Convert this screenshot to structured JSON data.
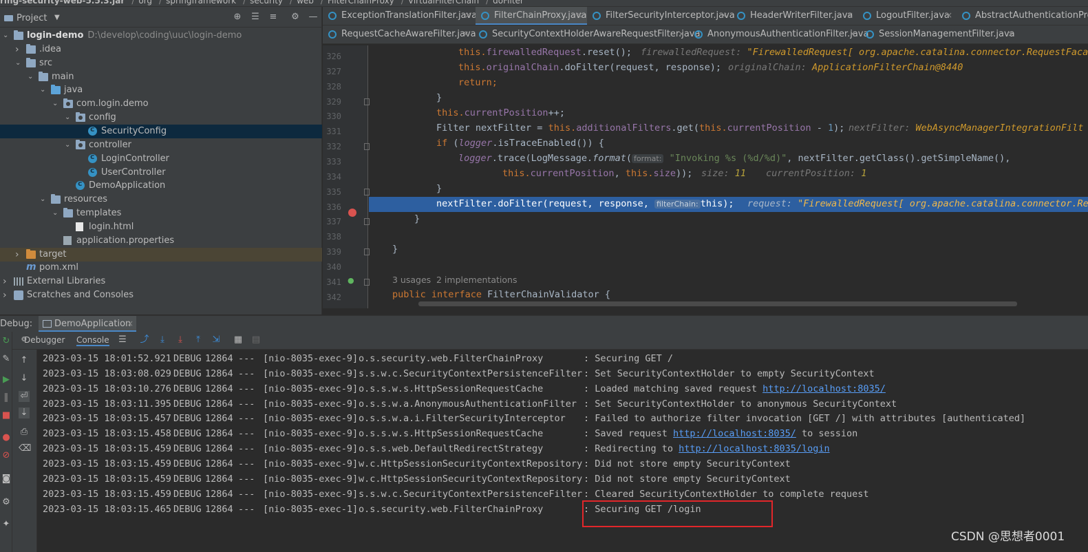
{
  "breadcrumb": {
    "items": [
      "ring-security-web-5.5.3.jar",
      "org",
      "springframework",
      "security",
      "web",
      "FilterChainProxy",
      "VirtualFilterChain",
      "doFilter"
    ]
  },
  "project": {
    "title": "Project",
    "tree": [
      {
        "label": "login-demo",
        "path": "D:\\develop\\coding\\uuc\\login-demo",
        "icon": "folder-icon",
        "level": 0,
        "expanded": true,
        "bold": true
      },
      {
        "label": ".idea",
        "icon": "folder-icon",
        "level": 1,
        "expanded": false
      },
      {
        "label": "src",
        "icon": "folder-icon",
        "level": 1,
        "expanded": true
      },
      {
        "label": "main",
        "icon": "folder-icon",
        "level": 2,
        "expanded": true
      },
      {
        "label": "java",
        "icon": "source-folder-icon",
        "level": 3,
        "expanded": true
      },
      {
        "label": "com.login.demo",
        "icon": "package-icon",
        "level": 4,
        "expanded": true
      },
      {
        "label": "config",
        "icon": "package-icon",
        "level": 5,
        "expanded": true
      },
      {
        "label": "SecurityConfig",
        "icon": "class-icon",
        "level": 6,
        "selected": true
      },
      {
        "label": "controller",
        "icon": "package-icon",
        "level": 5,
        "expanded": true
      },
      {
        "label": "LoginController",
        "icon": "class-icon",
        "level": 6
      },
      {
        "label": "UserController",
        "icon": "class-icon",
        "level": 6
      },
      {
        "label": "DemoApplication",
        "icon": "class-icon",
        "level": 5
      },
      {
        "label": "resources",
        "icon": "resources-folder-icon",
        "level": 3,
        "expanded": true
      },
      {
        "label": "templates",
        "icon": "folder-icon",
        "level": 4,
        "expanded": true
      },
      {
        "label": "login.html",
        "icon": "html-file-icon",
        "level": 5
      },
      {
        "label": "application.properties",
        "icon": "properties-file-icon",
        "level": 4
      },
      {
        "label": "target",
        "icon": "excluded-folder-icon",
        "level": 1,
        "expanded": false
      },
      {
        "label": "pom.xml",
        "icon": "maven-icon",
        "level": 1
      },
      {
        "label": "External Libraries",
        "icon": "libraries-icon",
        "level": 0,
        "expanded": false
      },
      {
        "label": "Scratches and Consoles",
        "icon": "scratches-icon",
        "level": 0,
        "expanded": false
      }
    ]
  },
  "editor": {
    "tabs_row1": [
      {
        "label": "ExceptionTranslationFilter.java",
        "active": false
      },
      {
        "label": "FilterChainProxy.java",
        "active": true
      },
      {
        "label": "FilterSecurityInterceptor.java",
        "active": false
      },
      {
        "label": "HeaderWriterFilter.java",
        "active": false
      },
      {
        "label": "LogoutFilter.java",
        "active": false
      },
      {
        "label": "AbstractAuthenticationPro",
        "active": false
      }
    ],
    "tabs_row2": [
      {
        "label": "RequestCacheAwareFilter.java",
        "active": false
      },
      {
        "label": "SecurityContextHolderAwareRequestFilter.java",
        "active": false
      },
      {
        "label": "AnonymousAuthenticationFilter.java",
        "active": false
      },
      {
        "label": "SessionManagementFilter.java",
        "active": false
      }
    ],
    "line_numbers": [
      "326",
      "327",
      "328",
      "329",
      "330",
      "331",
      "332",
      "333",
      "334",
      "335",
      "336",
      "337",
      "338",
      "339",
      "340",
      "341",
      "342"
    ],
    "code": {
      "l326a": "this.",
      "l326b": "firewalledRequest",
      "l326c": ".reset();",
      "l326h": "firewalledRequest:",
      "l326v": "\"FirewalledRequest[ org.apache.catalina.connector.RequestFaca",
      "l327a": "this.",
      "l327b": "originalChain",
      "l327c": ".doFilter(request, response);",
      "l327h": "originalChain:",
      "l327v": "ApplicationFilterChain@8440",
      "l328a": "return;",
      "l329a": "}",
      "l330a": "this.",
      "l330b": "currentPosition",
      "l330c": "++;",
      "l331a": "Filter nextFilter = ",
      "l331b": "this.",
      "l331c": "additionalFilters",
      "l331d": ".get(",
      "l331e": "this.",
      "l331f": "currentPosition",
      "l331g": " - ",
      "l331n": "1",
      "l331i": ");",
      "l331h": "nextFilter:",
      "l331v": "WebAsyncManagerIntegrationFilt",
      "l332a": "if",
      "l332b": " (",
      "l332c": "logger",
      "l332d": ".isTraceEnabled()) {",
      "l333a": "logger",
      "l333b": ".trace(LogMessage.",
      "l333c": "format",
      "l333d": "(",
      "l333p": "format:",
      "l333s": "\"Invoking %s (%d/%d)\"",
      "l333e": ", nextFilter.getClass().getSimpleName(),",
      "l334a": "this.",
      "l334b": "currentPosition",
      "l334c": ", ",
      "l334d": "this.",
      "l334e": "size",
      "l334f": "));",
      "l334h1": "size:",
      "l334v1": "11",
      "l334h2": "currentPosition:",
      "l334v2": "1",
      "l335a": "}",
      "l336a": "nextFilter.doFilter(request, response, ",
      "l336p": "filterChain:",
      "l336b": "this",
      "l336c": ");",
      "l336h": "request:",
      "l336v": "\"FirewalledRequest[ org.apache.catalina.connector.Re",
      "l337a": "}",
      "l339a": "}",
      "l340u1": "3 usages",
      "l340u2": "2 implementations",
      "l341a": "public interface",
      "l341b": " FilterChainValidator {"
    }
  },
  "debug": {
    "label": "Debug:",
    "session_tab": "DemoApplication",
    "subtabs": {
      "debugger": "Debugger",
      "console": "Console"
    }
  },
  "console": {
    "lines": [
      {
        "ts": "2023-03-15 18:01:52.921",
        "lvl": "DEBUG",
        "pid": "12864",
        "thread": "[nio-8035-exec-9]",
        "logger": "o.s.security.web.FilterChainProxy",
        "msg": ": Securing GET /",
        "link": "",
        "after": ""
      },
      {
        "ts": "2023-03-15 18:03:08.029",
        "lvl": "DEBUG",
        "pid": "12864",
        "thread": "[nio-8035-exec-9]",
        "logger": "s.s.w.c.SecurityContextPersistenceFilter",
        "msg": ": Set SecurityContextHolder to empty SecurityContext",
        "link": "",
        "after": ""
      },
      {
        "ts": "2023-03-15 18:03:10.276",
        "lvl": "DEBUG",
        "pid": "12864",
        "thread": "[nio-8035-exec-9]",
        "logger": "o.s.s.w.s.HttpSessionRequestCache",
        "msg": ": Loaded matching saved request ",
        "link": "http://localhost:8035/",
        "after": ""
      },
      {
        "ts": "2023-03-15 18:03:11.395",
        "lvl": "DEBUG",
        "pid": "12864",
        "thread": "[nio-8035-exec-9]",
        "logger": "o.s.s.w.a.AnonymousAuthenticationFilter",
        "msg": ": Set SecurityContextHolder to anonymous SecurityContext",
        "link": "",
        "after": ""
      },
      {
        "ts": "2023-03-15 18:03:15.457",
        "lvl": "DEBUG",
        "pid": "12864",
        "thread": "[nio-8035-exec-9]",
        "logger": "o.s.s.w.a.i.FilterSecurityInterceptor",
        "msg": ": Failed to authorize filter invocation [GET /] with attributes [authenticated]",
        "link": "",
        "after": ""
      },
      {
        "ts": "2023-03-15 18:03:15.458",
        "lvl": "DEBUG",
        "pid": "12864",
        "thread": "[nio-8035-exec-9]",
        "logger": "o.s.s.w.s.HttpSessionRequestCache",
        "msg": ": Saved request ",
        "link": "http://localhost:8035/",
        "after": " to session"
      },
      {
        "ts": "2023-03-15 18:03:15.459",
        "lvl": "DEBUG",
        "pid": "12864",
        "thread": "[nio-8035-exec-9]",
        "logger": "o.s.s.web.DefaultRedirectStrategy",
        "msg": ": Redirecting to ",
        "link": "http://localhost:8035/login",
        "after": ""
      },
      {
        "ts": "2023-03-15 18:03:15.459",
        "lvl": "DEBUG",
        "pid": "12864",
        "thread": "[nio-8035-exec-9]",
        "logger": "w.c.HttpSessionSecurityContextRepository",
        "msg": ": Did not store empty SecurityContext",
        "link": "",
        "after": ""
      },
      {
        "ts": "2023-03-15 18:03:15.459",
        "lvl": "DEBUG",
        "pid": "12864",
        "thread": "[nio-8035-exec-9]",
        "logger": "w.c.HttpSessionSecurityContextRepository",
        "msg": ": Did not store empty SecurityContext",
        "link": "",
        "after": ""
      },
      {
        "ts": "2023-03-15 18:03:15.459",
        "lvl": "DEBUG",
        "pid": "12864",
        "thread": "[nio-8035-exec-9]",
        "logger": "s.s.w.c.SecurityContextPersistenceFilter",
        "msg": ": Cleared SecurityContextHolder to complete request",
        "link": "",
        "after": ""
      },
      {
        "ts": "2023-03-15 18:03:15.465",
        "lvl": "DEBUG",
        "pid": "12864",
        "thread": "[nio-8035-exec-1]",
        "logger": "o.s.security.web.FilterChainProxy",
        "msg": ": Securing GET /login",
        "link": "",
        "after": ""
      }
    ]
  },
  "watermark": "CSDN @思想者0001",
  "colors": {
    "highlight_box": "#e2262a",
    "selection": "#2d5fa0",
    "link": "#589df6"
  }
}
